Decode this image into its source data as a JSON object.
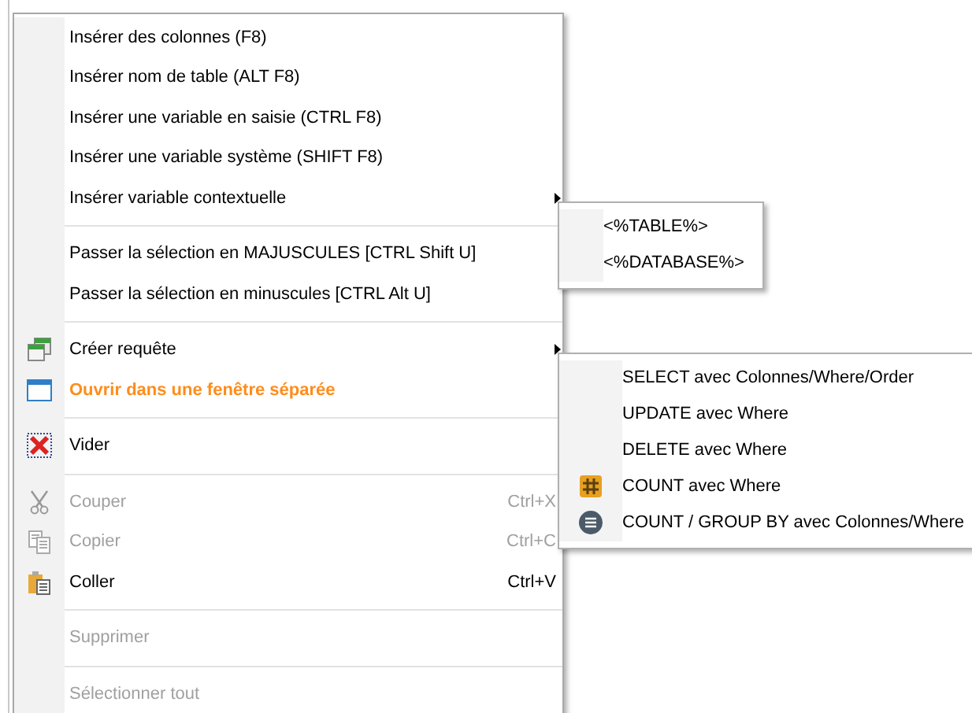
{
  "menu": {
    "items": [
      {
        "kind": "item",
        "label": "Insérer des colonnes (F8)",
        "disabled": false,
        "highlighted": false
      },
      {
        "kind": "item",
        "label": "Insérer nom de table (ALT F8)",
        "disabled": false,
        "highlighted": false
      },
      {
        "kind": "item",
        "label": "Insérer une variable en saisie (CTRL F8)",
        "disabled": false,
        "highlighted": false
      },
      {
        "kind": "item",
        "label": "Insérer une variable système (SHIFT F8)",
        "disabled": false,
        "highlighted": false
      },
      {
        "kind": "item",
        "label": "Insérer variable contextuelle",
        "disabled": false,
        "highlighted": false,
        "expanded": true,
        "children": [
          {
            "label": "<%TABLE%>"
          },
          {
            "label": "<%DATABASE%>"
          }
        ]
      },
      {
        "kind": "separator"
      },
      {
        "kind": "item",
        "label": "Passer la sélection en MAJUSCULES [CTRL Shift U]",
        "disabled": false,
        "highlighted": false
      },
      {
        "kind": "item",
        "label": "Passer la sélection en minuscules [CTRL Alt U]",
        "disabled": false,
        "highlighted": false
      },
      {
        "kind": "separator"
      },
      {
        "kind": "item",
        "label": "Créer requête",
        "disabled": false,
        "highlighted": false,
        "expanded": true,
        "children": [
          {
            "label": "SELECT avec Colonnes/Where/Order"
          },
          {
            "label": "UPDATE avec Where"
          },
          {
            "label": "DELETE avec Where"
          },
          {
            "label": "COUNT avec Where"
          },
          {
            "label": "COUNT / GROUP BY avec Colonnes/Where"
          }
        ]
      },
      {
        "kind": "item",
        "label": "Ouvrir dans une fenêtre séparée",
        "disabled": false,
        "highlighted": true
      },
      {
        "kind": "separator"
      },
      {
        "kind": "item",
        "label": "Vider",
        "disabled": false,
        "highlighted": false
      },
      {
        "kind": "separator"
      },
      {
        "kind": "item",
        "label": "Couper",
        "shortcut": "Ctrl+X",
        "disabled": true,
        "highlighted": false
      },
      {
        "kind": "item",
        "label": "Copier",
        "shortcut": "Ctrl+C",
        "disabled": true,
        "highlighted": false
      },
      {
        "kind": "item",
        "label": "Coller",
        "shortcut": "Ctrl+V",
        "disabled": false,
        "highlighted": false
      },
      {
        "kind": "separator"
      },
      {
        "kind": "item",
        "label": "Supprimer",
        "disabled": true,
        "highlighted": false
      },
      {
        "kind": "separator"
      },
      {
        "kind": "item",
        "label": "Sélectionner tout",
        "disabled": true,
        "highlighted": false
      }
    ]
  }
}
